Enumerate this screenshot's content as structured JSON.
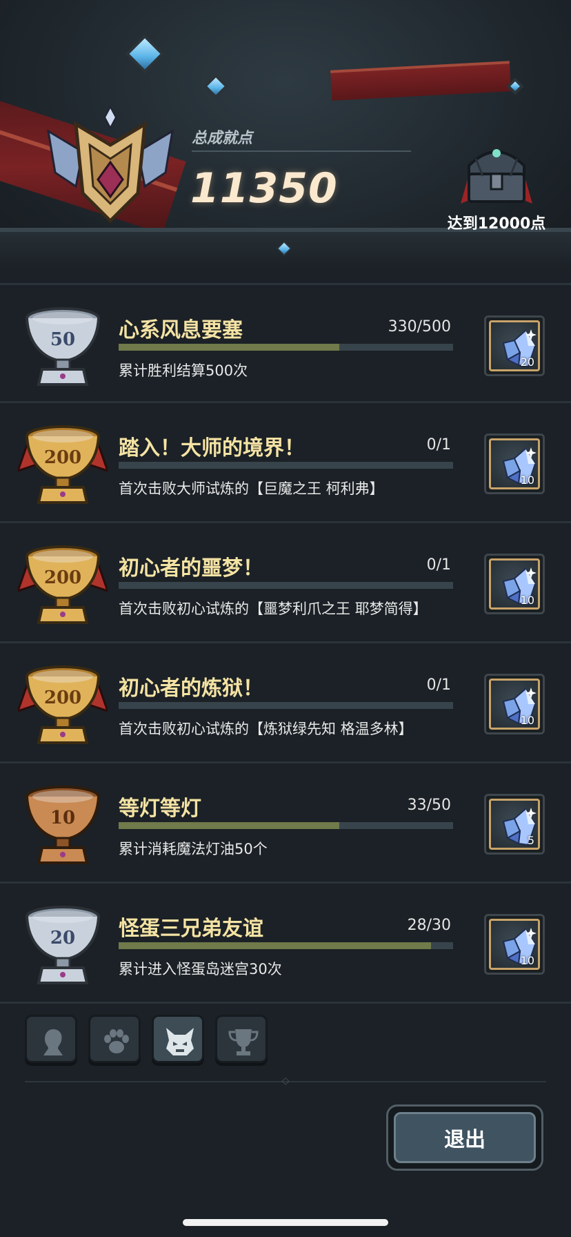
{
  "header": {
    "total_label": "总成就点",
    "total_value": "11350",
    "next_reward_label": "达到12000点"
  },
  "achievements": [
    {
      "badge": "50",
      "title": "心系风息要塞",
      "progress": "330/500",
      "progress_fraction": 0.66,
      "desc": "累计胜利结算500次",
      "reward_count": "20",
      "trophy": "silver"
    },
    {
      "badge": "200",
      "title": "踏入！大师的境界！",
      "progress": "0/1",
      "progress_fraction": 0,
      "desc": "首次击败大师试炼的【巨魔之王 柯利弗】",
      "reward_count": "10",
      "trophy": "gold"
    },
    {
      "badge": "200",
      "title": "初心者的噩梦！",
      "progress": "0/1",
      "progress_fraction": 0,
      "desc": "首次击败初心试炼的【噩梦利爪之王 耶梦简得】",
      "reward_count": "10",
      "trophy": "gold"
    },
    {
      "badge": "200",
      "title": "初心者的炼狱！",
      "progress": "0/1",
      "progress_fraction": 0,
      "desc": "首次击败初心试炼的【炼狱绿先知 格温多林】",
      "reward_count": "10",
      "trophy": "gold"
    },
    {
      "badge": "10",
      "title": "等灯等灯",
      "progress": "33/50",
      "progress_fraction": 0.66,
      "desc": "累计消耗魔法灯油50个",
      "reward_count": "5",
      "trophy": "bronze"
    },
    {
      "badge": "20",
      "title": "怪蛋三兄弟友谊",
      "progress": "28/30",
      "progress_fraction": 0.933,
      "desc": "累计进入怪蛋岛迷宫30次",
      "reward_count": "10",
      "trophy": "silver"
    }
  ],
  "tabs": [
    {
      "icon": "hero-silhouette-icon",
      "active": false
    },
    {
      "icon": "paw-icon",
      "active": false
    },
    {
      "icon": "monster-head-icon",
      "active": true
    },
    {
      "icon": "trophy-icon",
      "active": false
    }
  ],
  "exit_label": "退出",
  "colors": {
    "title": "#f5e3a4",
    "bar_fill": "#707a4a",
    "bar_bg": "#38444c",
    "background": "#1b2126"
  }
}
